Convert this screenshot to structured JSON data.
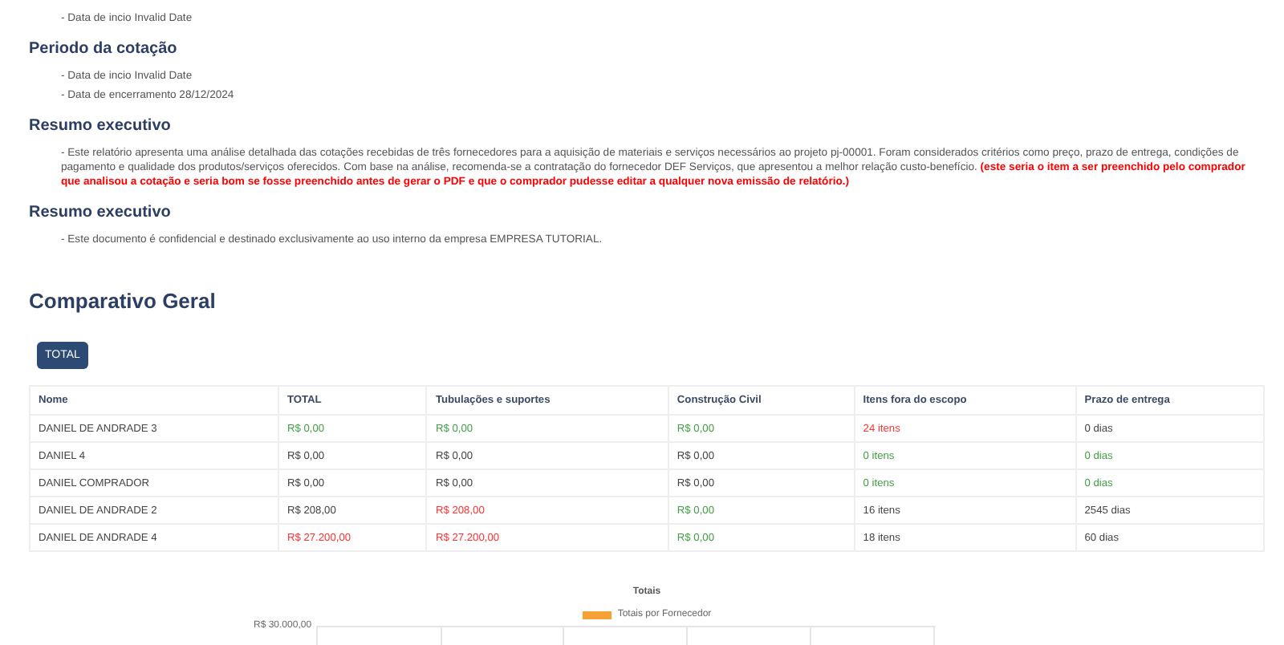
{
  "sections": [
    {
      "lines": [
        "- Data de incio Invalid Date"
      ]
    },
    {
      "heading": "Periodo da cotação",
      "lines": [
        "- Data de incio Invalid Date",
        "- Data de encerramento 28/12/2024"
      ]
    },
    {
      "heading": "Resumo executivo",
      "lines": [
        "- Este relatório apresenta uma análise detalhada das cotações recebidas de três fornecedores para a aquisição de materiais e serviços necessários ao projeto pj-00001. Foram considerados critérios como preço, prazo de entrega, condições de pagamento e qualidade dos produtos/serviços oferecidos. Com base na análise, recomenda-se a contratação do fornecedor DEF Serviços, que apresentou a melhor relação custo-benefício."
      ],
      "note": "(este seria o item a ser preenchido pelo comprador que analisou a cotação e seria bom se fosse preenchido antes de gerar o PDF e que o comprador pudesse editar a qualquer nova emissão de relatório.)"
    },
    {
      "heading": "Resumo executivo",
      "lines": [
        "- Este documento é confidencial e destinado exclusivamente ao uso interno da empresa EMPRESA TUTORIAL."
      ]
    }
  ],
  "comparison": {
    "title": "Comparativo Geral",
    "tabs": [
      {
        "label": "TOTAL",
        "selected": true
      }
    ],
    "columns": [
      "Nome",
      "TOTAL",
      "Tubulações e suportes",
      "Construção Civil",
      "Itens fora do escopo",
      "Prazo de entrega"
    ],
    "rows": [
      [
        {
          "text": "DANIEL DE ANDRADE 3",
          "color": "#444444"
        },
        {
          "text": "R$ 0,00",
          "color": "#43a047"
        },
        {
          "text": "R$ 0,00",
          "color": "#43a047"
        },
        {
          "text": "R$ 0,00",
          "color": "#43a047"
        },
        {
          "text": "24 itens",
          "color": "#ff3333"
        },
        {
          "text": "0 dias",
          "color": "#444444"
        }
      ],
      [
        {
          "text": "DANIEL 4",
          "color": "#444444"
        },
        {
          "text": "R$ 0,00",
          "color": "#444444"
        },
        {
          "text": "R$ 0,00",
          "color": "#444444"
        },
        {
          "text": "R$ 0,00",
          "color": "#444444"
        },
        {
          "text": "0 itens",
          "color": "#43a047"
        },
        {
          "text": "0 dias",
          "color": "#43a047"
        }
      ],
      [
        {
          "text": "DANIEL COMPRADOR",
          "color": "#444444"
        },
        {
          "text": "R$ 0,00",
          "color": "#444444"
        },
        {
          "text": "R$ 0,00",
          "color": "#444444"
        },
        {
          "text": "R$ 0,00",
          "color": "#444444"
        },
        {
          "text": "0 itens",
          "color": "#43a047"
        },
        {
          "text": "0 dias",
          "color": "#43a047"
        }
      ],
      [
        {
          "text": "DANIEL DE ANDRADE 2",
          "color": "#444444"
        },
        {
          "text": "R$ 208,00",
          "color": "#444444"
        },
        {
          "text": "R$ 208,00",
          "color": "#ff3333"
        },
        {
          "text": "R$ 0,00",
          "color": "#43a047"
        },
        {
          "text": "16 itens",
          "color": "#444444"
        },
        {
          "text": "2545 dias",
          "color": "#444444"
        }
      ],
      [
        {
          "text": "DANIEL DE ANDRADE 4",
          "color": "#444444"
        },
        {
          "text": "R$ 27.200,00",
          "color": "#ff3333"
        },
        {
          "text": "R$ 27.200,00",
          "color": "#ff3333"
        },
        {
          "text": "R$ 0,00",
          "color": "#43a047"
        },
        {
          "text": "18 itens",
          "color": "#444444"
        },
        {
          "text": "60 dias",
          "color": "#444444"
        }
      ]
    ]
  },
  "chart": {
    "title": "Totais",
    "legend": {
      "label": "Totais por Fornecedor",
      "color": "#f7a035"
    },
    "y_tick": "R$ 30.000,00"
  }
}
